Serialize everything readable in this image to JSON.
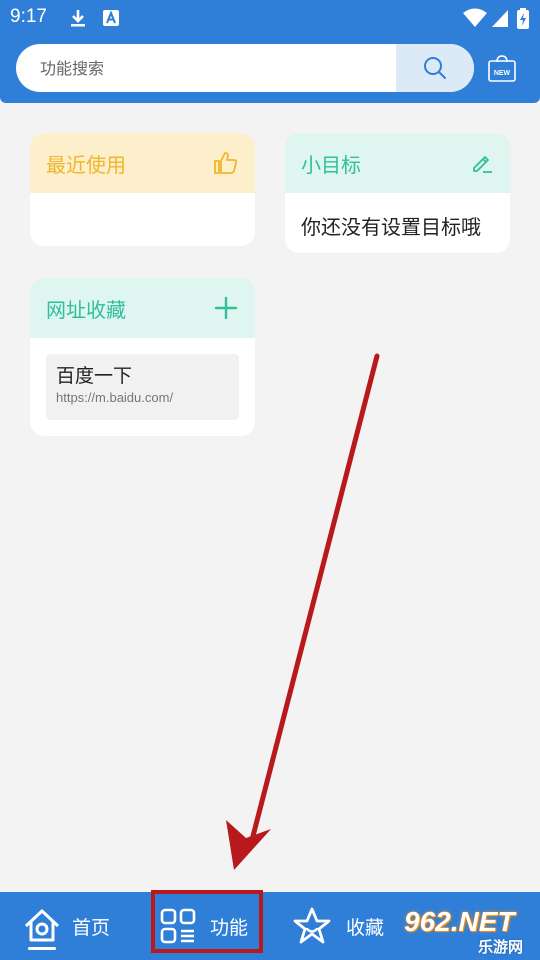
{
  "status_bar": {
    "time": "9:17"
  },
  "search": {
    "placeholder": "功能搜索"
  },
  "new_badge": "NEW",
  "cards": {
    "recent": {
      "title": "最近使用"
    },
    "goal": {
      "title": "小目标",
      "empty_text": "你还没有设置目标哦"
    },
    "bookmarks": {
      "title": "网址收藏",
      "items": [
        {
          "title": "百度一下",
          "url": "https://m.baidu.com/"
        }
      ]
    }
  },
  "tabbar": {
    "home": "首页",
    "functions": "功能",
    "favorites": "收藏"
  },
  "watermark": {
    "main": "962.NET",
    "sub": "乐游网"
  },
  "colors": {
    "primary": "#2f7fd8",
    "amber": "#f0b52a",
    "teal": "#2fbf9a",
    "annotation": "#b8191c"
  }
}
